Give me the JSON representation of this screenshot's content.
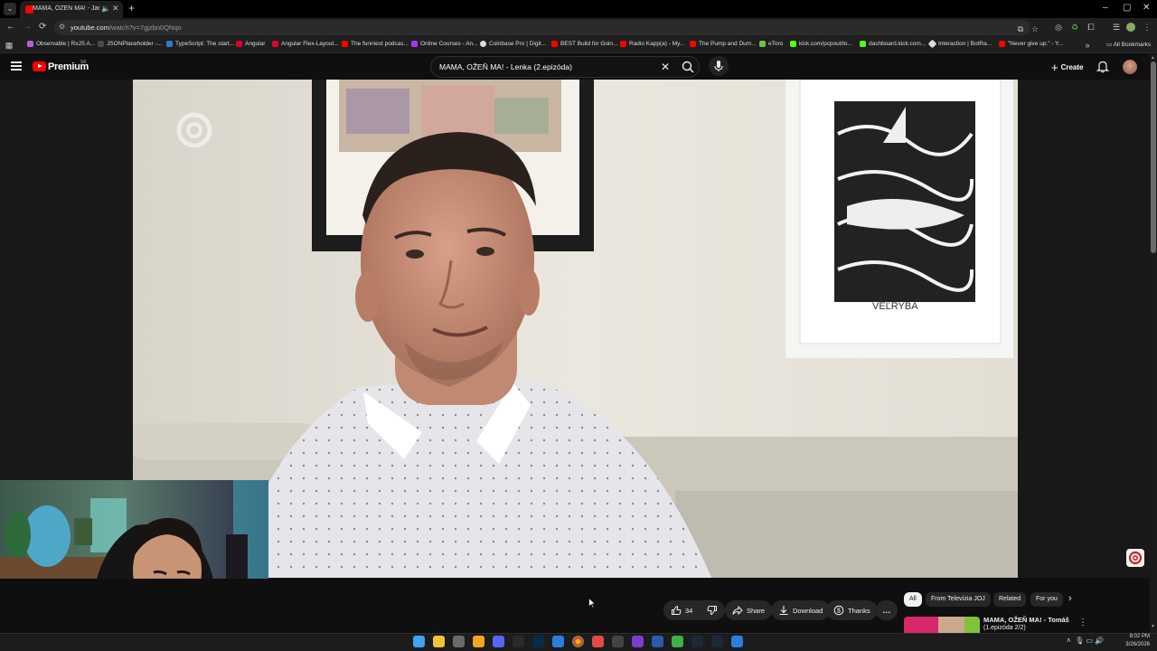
{
  "browser": {
    "tab_title": "MAMA, OŽEŇ MA! - Jarka",
    "url_host": "youtube.com",
    "url_path": "/watch?v=7gjzbn0QNqo",
    "colors": {
      "frame": "#000000",
      "toolbar": "#1f1f1f",
      "accent": "#ff0000"
    }
  },
  "bookmarks": {
    "items": [
      {
        "label": "Observable | RxJS A...",
        "color": "#b35fd8"
      },
      {
        "label": "JSONPlaceholder -...",
        "color": "#4a4a4a"
      },
      {
        "label": "TypeScript: The start...",
        "color": "#3178c6"
      },
      {
        "label": "Angular",
        "color": "#dd0031"
      },
      {
        "label": "Angular Flex-Layout...",
        "color": "#dd0031"
      },
      {
        "label": "The funniest podcas...",
        "color": "#ff0000"
      },
      {
        "label": "Online Courses - An...",
        "color": "#a435f0"
      },
      {
        "label": "Coinbase Pro | Digit...",
        "color": "#dddddd"
      },
      {
        "label": "BEST Build for Goin...",
        "color": "#ff0000"
      },
      {
        "label": "Radio Kapp(a) - My...",
        "color": "#ff0000"
      },
      {
        "label": "The Pump and Dum...",
        "color": "#ff0000"
      },
      {
        "label": "eToro",
        "color": "#6cc24a"
      },
      {
        "label": "kick.com/pcpout/lo...",
        "color": "#53fc18"
      },
      {
        "label": "dashboard.kick.com...",
        "color": "#53fc18"
      },
      {
        "label": "Interaction | BotRa...",
        "color": "#dddddd"
      },
      {
        "label": "\"Never give up.\" - Y...",
        "color": "#ff0000"
      }
    ],
    "all_label": "All Bookmarks"
  },
  "youtube": {
    "brand": "Premium",
    "region": "SK",
    "search_query": "MAMA, OŽEŇ MA! - Lenka (2.epizóda)",
    "create_label": "Create"
  },
  "actions": {
    "like_count": "34",
    "share_label": "Share",
    "download_label": "Download",
    "thanks_label": "Thanks",
    "more_label": "..."
  },
  "chips": {
    "items": [
      {
        "label": "All",
        "active": true
      },
      {
        "label": "From Televízia JOJ",
        "active": false
      },
      {
        "label": "Related",
        "active": false
      },
      {
        "label": "For you",
        "active": false
      }
    ]
  },
  "recommendation": {
    "title": "MAMA, OŽEŇ MA! - Tomáš",
    "subtitle": "(1.epizóda 2/2)"
  },
  "taskbar": {
    "time": "8:02 PM",
    "date": "3/26/2026"
  }
}
